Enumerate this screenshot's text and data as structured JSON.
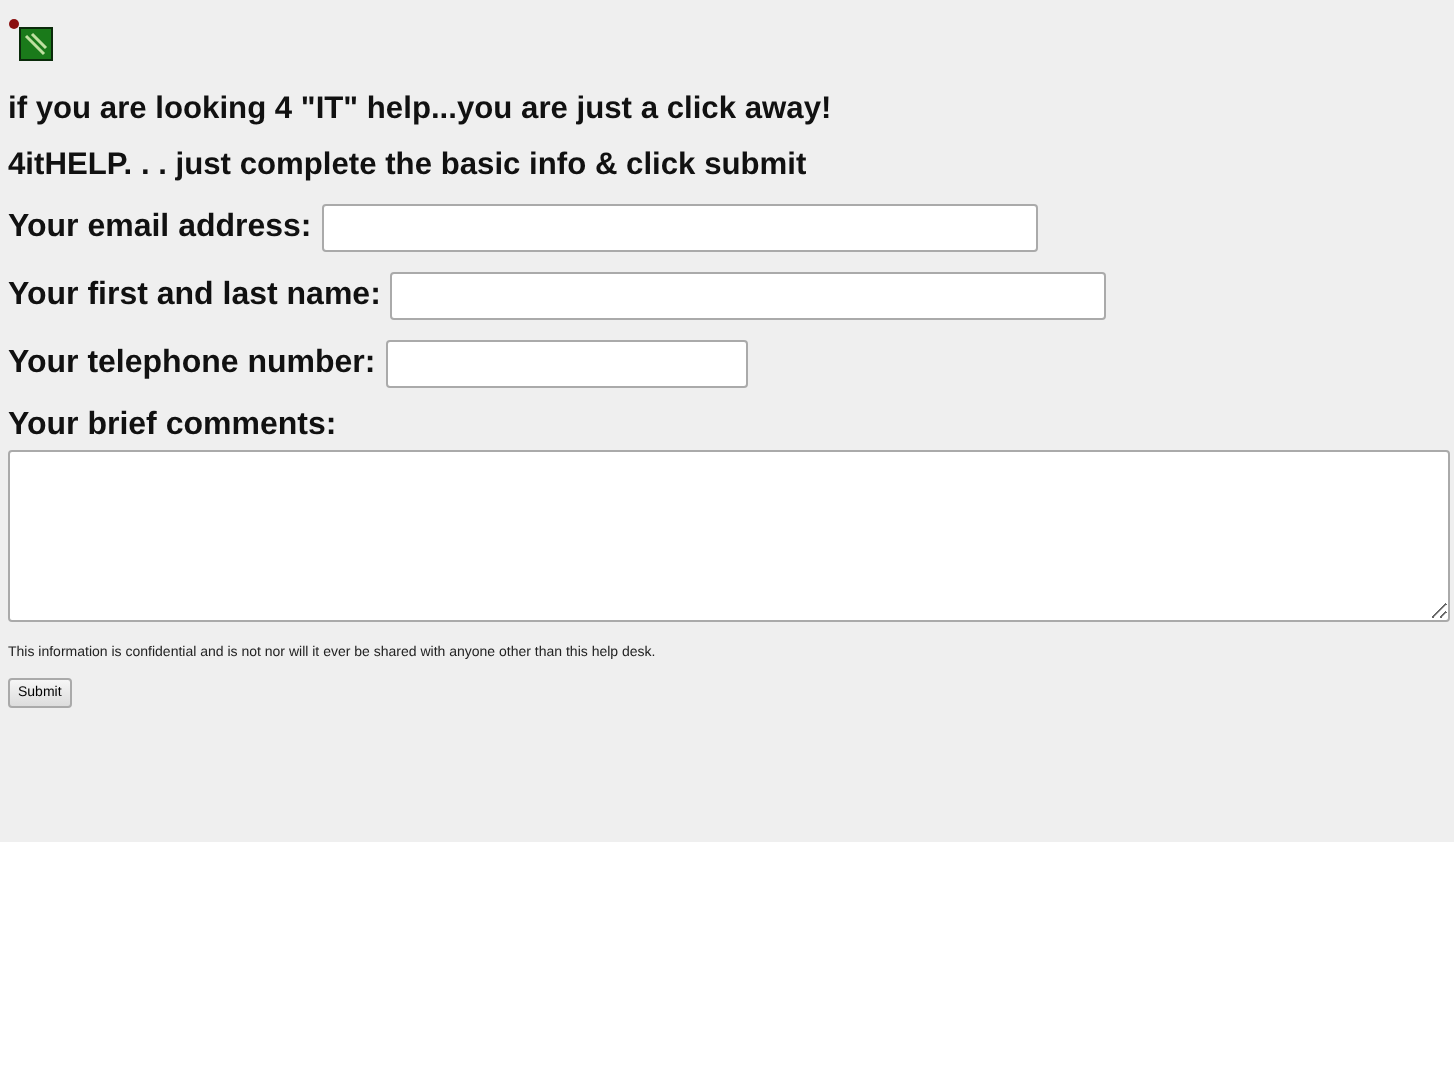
{
  "headline": "if you are looking 4 \"IT\" help...you are just a click away!",
  "subheadline": "4itHELP. . . just complete the basic info & click submit",
  "fields": [
    {
      "label": "Your email address:",
      "kind": "line"
    },
    {
      "label": "Your first and last name:",
      "kind": "line"
    },
    {
      "label": "Your telephone number:",
      "kind": "line"
    },
    {
      "label": "Your brief comments:",
      "kind": "area"
    }
  ],
  "notice": "This information is confidential and is not nor will it ever be shared with anyone other than this help desk.",
  "submit": "Submit"
}
